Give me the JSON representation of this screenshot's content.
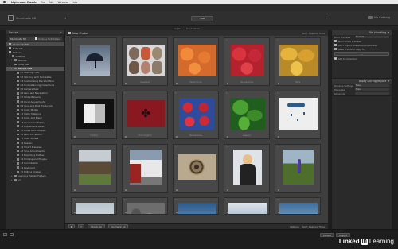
{
  "macmenu": {
    "items": [
      "Lightroom Classic",
      "File",
      "Edit",
      "Window",
      "Help"
    ]
  },
  "identity": {
    "catalog": "Illuminate 88",
    "module_center": "sss",
    "sync_label": "No Catalog"
  },
  "collapse_tabs": [
    "Import",
    "Destination"
  ],
  "left_panel": {
    "title": "Source",
    "source_selector": "Illuminate 88",
    "include_sub": "Include Subfolders",
    "volumes": [
      "Illuminate 88",
      "Network",
      "Kakerrr..."
    ],
    "tree": [
      {
        "label": "Desktop",
        "level": 1
      },
      {
        "label": "All Files",
        "level": 2
      },
      {
        "label": "Class files",
        "level": 2
      },
      {
        "label": "Sample files",
        "level": 2,
        "selected": true
      },
      {
        "label": "01 Starting Files",
        "level": 3
      },
      {
        "label": "02 Working with Templates",
        "level": 3
      },
      {
        "label": "03 Customizing the Workflow",
        "level": 3
      },
      {
        "label": "04 Understanding Collections",
        "level": 3
      },
      {
        "label": "05 Camera Raw",
        "level": 3
      },
      {
        "label": "06 Lens and Navigation",
        "level": 3
      },
      {
        "label": "07 White Balance",
        "level": 3
      },
      {
        "label": "08 Local Adjustments",
        "level": 3
      },
      {
        "label": "09 Tone and Post Production",
        "level": 3
      },
      {
        "label": "10 Color Modes",
        "level": 3
      },
      {
        "label": "11 Slider Mapping",
        "level": 3
      },
      {
        "label": "12 Color and Black",
        "level": 3
      },
      {
        "label": "13 Local Color Editing",
        "level": 3
      },
      {
        "label": "14 Adjustment Layers",
        "level": 3
      },
      {
        "label": "15 Noise and Sharpen",
        "level": 3
      },
      {
        "label": "16 Lens Correction",
        "level": 3
      },
      {
        "label": "17 Color Modes",
        "level": 3
      },
      {
        "label": "18 Rescan",
        "level": 3
      },
      {
        "label": "19 Smart Previews",
        "level": 3
      },
      {
        "label": "20 Tone Adjustments",
        "level": 3
      },
      {
        "label": "21 Exporting Profiles",
        "level": 3
      },
      {
        "label": "22 Printing and Plugins",
        "level": 3
      },
      {
        "label": "23 Contribution",
        "level": 3
      },
      {
        "label": "24 Keyboard",
        "level": 3
      },
      {
        "label": "25 Editing Images",
        "level": 3
      },
      {
        "label": "Learning Publish Folders",
        "level": 2
      },
      {
        "label": "Lrc",
        "level": 2
      }
    ]
  },
  "grid": {
    "title": "New Photos",
    "sort": "Sort: Capture Time",
    "cells": [
      {
        "idx": "1",
        "caption": "",
        "kind": "umbrella"
      },
      {
        "idx": "2",
        "caption": "Seashells",
        "kind": "shells"
      },
      {
        "idx": "3",
        "caption": "Persimmons",
        "kind": "persimmon"
      },
      {
        "idx": "4",
        "caption": "Strawberries",
        "kind": "strawberry"
      },
      {
        "idx": "5",
        "caption": "Yams",
        "kind": "yams"
      },
      {
        "idx": "6",
        "caption": "Folding",
        "kind": "fold"
      },
      {
        "idx": "7",
        "caption": "Hummingbird",
        "kind": "hummingbird"
      },
      {
        "idx": "8",
        "caption": "Strawberries",
        "kind": "baskets"
      },
      {
        "idx": "9",
        "caption": "Peppers",
        "kind": "peppers"
      },
      {
        "idx": "10",
        "caption": "",
        "kind": "rain"
      },
      {
        "idx": "11",
        "caption": "",
        "kind": "cabin"
      },
      {
        "idx": "12",
        "caption": "",
        "kind": "building"
      },
      {
        "idx": "13",
        "caption": "",
        "kind": "snail"
      },
      {
        "idx": "14",
        "caption": "",
        "kind": "woman"
      },
      {
        "idx": "15",
        "caption": "",
        "kind": "lupine"
      },
      {
        "idx": "16",
        "caption": "",
        "kind": "sky"
      },
      {
        "idx": "17",
        "caption": "",
        "kind": "stones"
      },
      {
        "idx": "18",
        "caption": "",
        "kind": "sky2"
      },
      {
        "idx": "19",
        "caption": "",
        "kind": "bluesky"
      },
      {
        "idx": "20",
        "caption": "",
        "kind": "clouds"
      }
    ]
  },
  "toolbar": {
    "check_all": "Check All",
    "uncheck_all": "Uncheck All",
    "filter_label": "Options",
    "sort_label": "Sort: Capture Time"
  },
  "right_panel": {
    "file_handling_title": "File Handling",
    "build_previews_label": "Build Previews",
    "build_previews_value": "Minimal",
    "smart_previews": "Build Smart Previews",
    "dont_import_dupes": "Don't Import Suspected Duplicates",
    "second_copy": "Make a Second Copy To",
    "add_to_collection": "Add to Collection",
    "apply_title": "Apply During Import",
    "dev_label": "Develop Settings",
    "dev_value": "None",
    "meta_label": "Metadata",
    "meta_value": "None",
    "kw_label": "Keywords"
  },
  "bottom": {
    "cancel": "Cancel",
    "import": "Import",
    "brand_in": "in",
    "brand_linked": "Linked",
    "brand_learning": "Learning"
  }
}
